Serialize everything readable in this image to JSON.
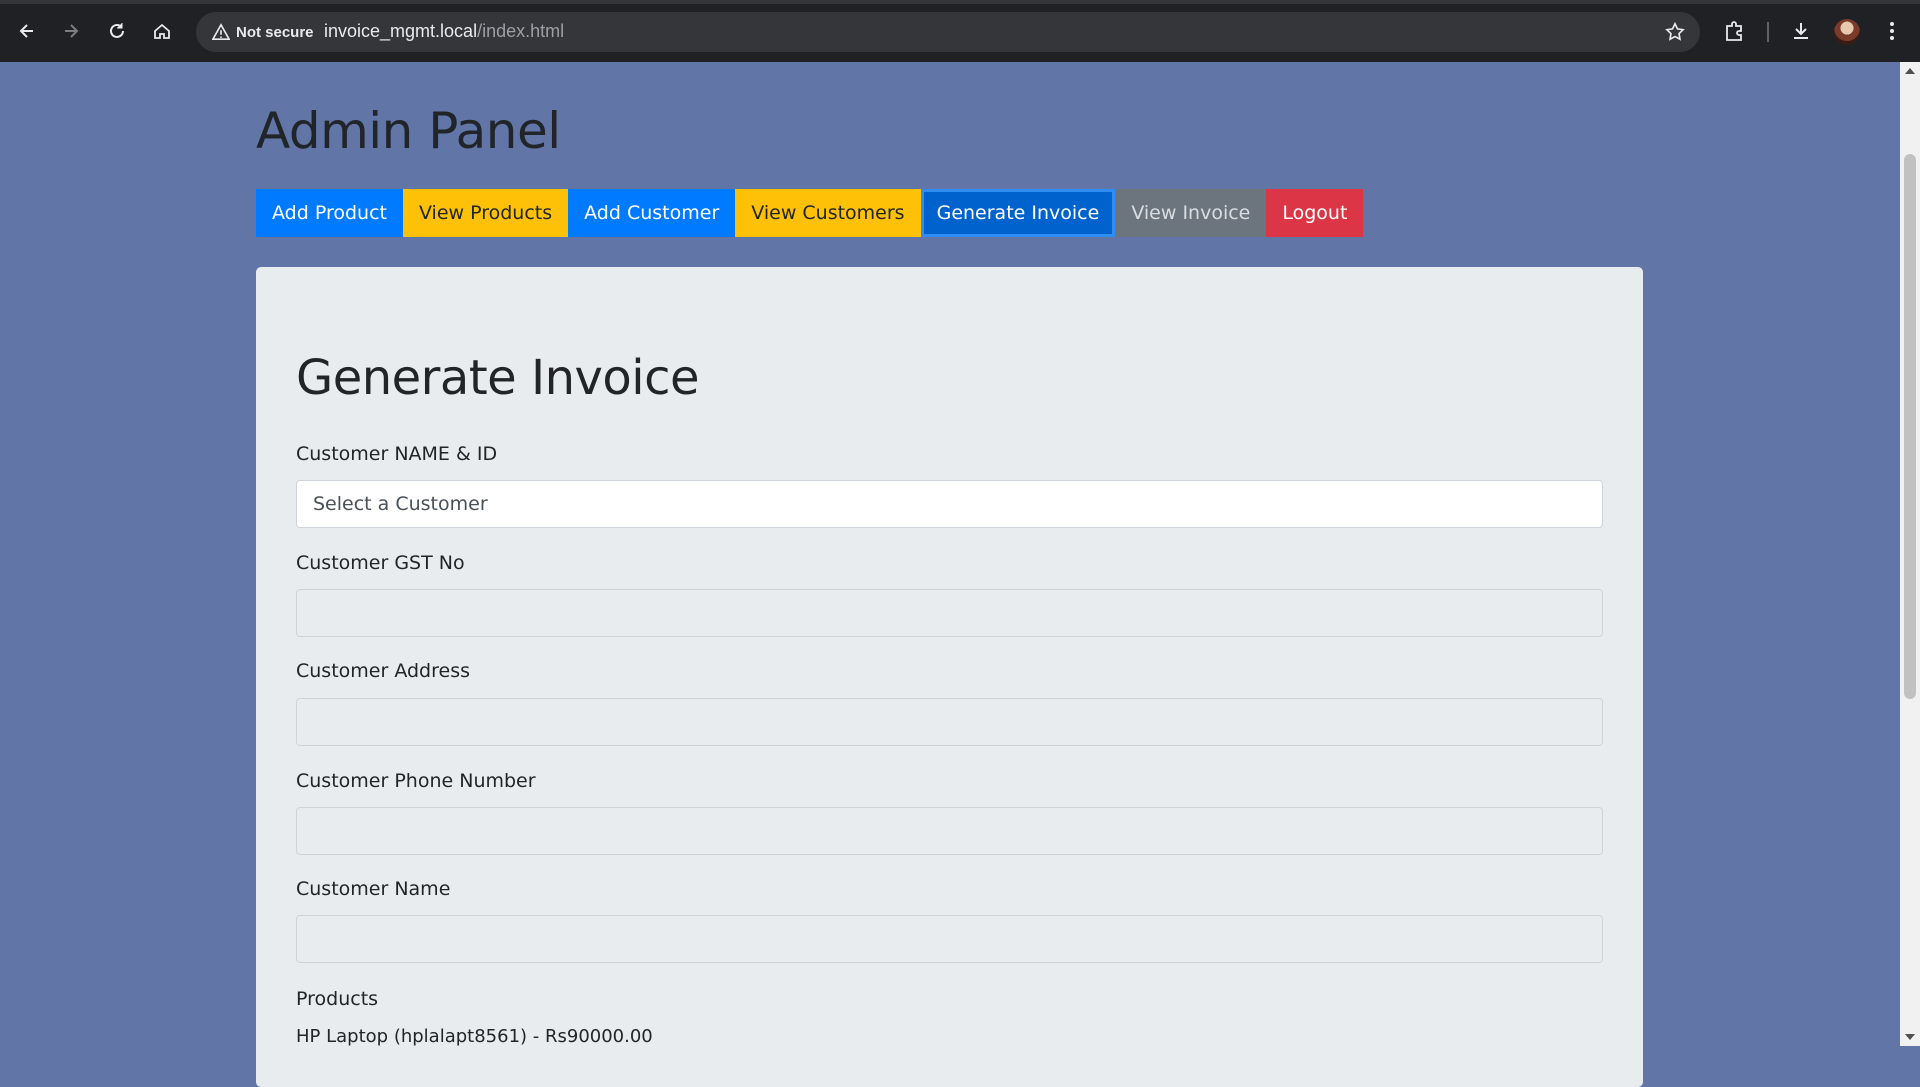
{
  "browser": {
    "security_label": "Not secure",
    "url_host": "invoice_mgmt.local",
    "url_path": "/index.html"
  },
  "page": {
    "title": "Admin Panel",
    "nav": [
      {
        "label": "Add Product",
        "style": "primary"
      },
      {
        "label": "View Products",
        "style": "warning"
      },
      {
        "label": "Add Customer",
        "style": "primary"
      },
      {
        "label": "View Customers",
        "style": "warning"
      },
      {
        "label": "Generate Invoice",
        "style": "primary",
        "active": true
      },
      {
        "label": "View Invoice",
        "style": "secondary"
      },
      {
        "label": "Logout",
        "style": "danger"
      }
    ]
  },
  "form": {
    "heading": "Generate Invoice",
    "customer_select_label": "Customer NAME & ID",
    "customer_select_value": "Select a Customer",
    "gst_label": "Customer GST No",
    "gst_value": "",
    "address_label": "Customer Address",
    "address_value": "",
    "phone_label": "Customer Phone Number",
    "phone_value": "",
    "name_label": "Customer Name",
    "name_value": "",
    "products_label": "Products",
    "products": [
      "HP Laptop (hplalapt8561) - Rs90000.00"
    ]
  },
  "colors": {
    "page_background": "#6176a6",
    "primary": "#007bff",
    "warning": "#ffc107",
    "secondary": "#6c757d",
    "danger": "#dc3545"
  }
}
